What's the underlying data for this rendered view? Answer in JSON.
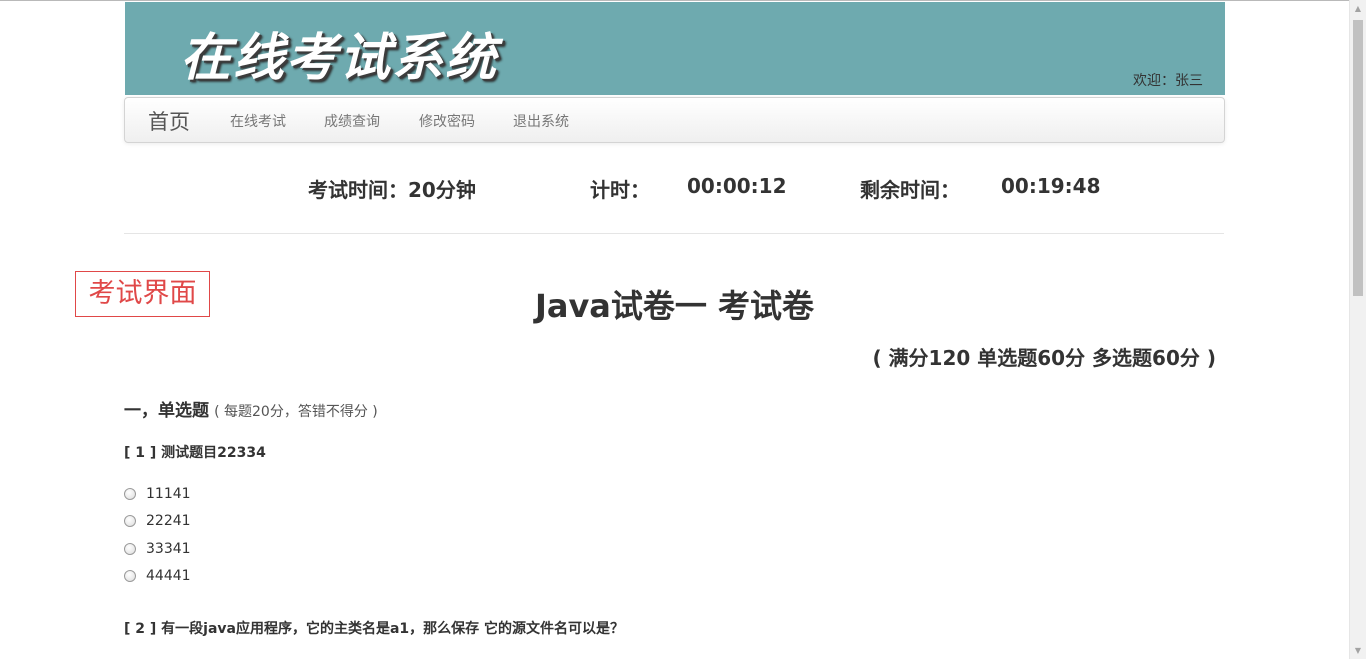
{
  "header": {
    "title": "在线考试系统",
    "welcome": "欢迎：张三"
  },
  "nav": {
    "brand": "首页",
    "items": [
      "在线考试",
      "成绩查询",
      "修改密码",
      "退出系统"
    ]
  },
  "timer": {
    "exam_time": "考试时间：20分钟",
    "elapsed_label": "计时：",
    "elapsed_value": "00:00:12",
    "remaining_label": "剩余时间：",
    "remaining_value": "00:19:48"
  },
  "stamp": "考试界面",
  "paper": {
    "title": "Java试卷一  考试卷",
    "score_line": "( 满分120  单选题60分  多选题60分 )"
  },
  "section": {
    "title": "一，单选题",
    "note": "( 每题20分，答错不得分 )"
  },
  "questions": [
    {
      "label": "[ 1 ] 测试题目22334",
      "options": [
        "11141",
        "22241",
        "33341",
        "44441"
      ]
    },
    {
      "label": "[ 2 ] 有一段java应用程序，它的主类名是a1，那么保存 它的源文件名可以是？"
    }
  ],
  "colors": {
    "banner_bg": "#6eaaaf",
    "stamp_red": "#e04848"
  }
}
